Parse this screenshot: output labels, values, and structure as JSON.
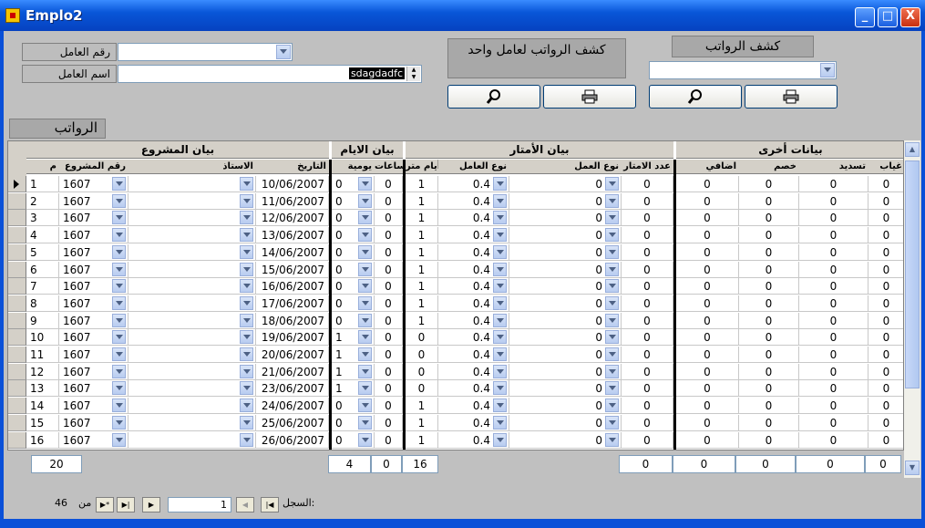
{
  "window": {
    "title": "Emplo2",
    "min": "_",
    "max": "□",
    "close": "X"
  },
  "worker": {
    "id_label": "رقم العامل",
    "name_label": "اسم العامل",
    "name_value": "sdagdadfc"
  },
  "single_report": {
    "title": "كشف الرواتب لعامل واحد",
    "preview_icon": "magnifier-icon",
    "print_icon": "printer-icon"
  },
  "payroll_report": {
    "title": "كشف الرواتب",
    "preview_icon": "magnifier-icon",
    "print_icon": "printer-icon"
  },
  "section_label": "الرواتب",
  "groups": {
    "project": "بيان المشروع",
    "days": "بيان الايام",
    "meters": "بيان الأمتار",
    "other": "بيانات أخرى"
  },
  "columns": {
    "num": "م",
    "project_no": "رقم المشروع",
    "master": "الاستاذ",
    "date": "التاريخ",
    "daily": "يومية",
    "hours": "ساعات",
    "meter_days": "أيام متر",
    "worker_type": "نوع العامل",
    "work_type": "نوع العمل",
    "meter_count": "عدد الامتار",
    "extra": "اضافي",
    "deduction": "خصم",
    "payment": "تسديد",
    "absence": "غياب"
  },
  "rows": [
    {
      "n": "1",
      "p": "1607",
      "d": "10/06/2007",
      "dy": "0",
      "h": "0",
      "md": "1",
      "wt": "0.4",
      "wk": "0",
      "mc": "0",
      "ex": "0",
      "de": "0",
      "pa": "0",
      "ab": "0"
    },
    {
      "n": "2",
      "p": "1607",
      "d": "11/06/2007",
      "dy": "0",
      "h": "0",
      "md": "1",
      "wt": "0.4",
      "wk": "0",
      "mc": "0",
      "ex": "0",
      "de": "0",
      "pa": "0",
      "ab": "0"
    },
    {
      "n": "3",
      "p": "1607",
      "d": "12/06/2007",
      "dy": "0",
      "h": "0",
      "md": "1",
      "wt": "0.4",
      "wk": "0",
      "mc": "0",
      "ex": "0",
      "de": "0",
      "pa": "0",
      "ab": "0"
    },
    {
      "n": "4",
      "p": "1607",
      "d": "13/06/2007",
      "dy": "0",
      "h": "0",
      "md": "1",
      "wt": "0.4",
      "wk": "0",
      "mc": "0",
      "ex": "0",
      "de": "0",
      "pa": "0",
      "ab": "0"
    },
    {
      "n": "5",
      "p": "1607",
      "d": "14/06/2007",
      "dy": "0",
      "h": "0",
      "md": "1",
      "wt": "0.4",
      "wk": "0",
      "mc": "0",
      "ex": "0",
      "de": "0",
      "pa": "0",
      "ab": "0"
    },
    {
      "n": "6",
      "p": "1607",
      "d": "15/06/2007",
      "dy": "0",
      "h": "0",
      "md": "1",
      "wt": "0.4",
      "wk": "0",
      "mc": "0",
      "ex": "0",
      "de": "0",
      "pa": "0",
      "ab": "0"
    },
    {
      "n": "7",
      "p": "1607",
      "d": "16/06/2007",
      "dy": "0",
      "h": "0",
      "md": "1",
      "wt": "0.4",
      "wk": "0",
      "mc": "0",
      "ex": "0",
      "de": "0",
      "pa": "0",
      "ab": "0"
    },
    {
      "n": "8",
      "p": "1607",
      "d": "17/06/2007",
      "dy": "0",
      "h": "0",
      "md": "1",
      "wt": "0.4",
      "wk": "0",
      "mc": "0",
      "ex": "0",
      "de": "0",
      "pa": "0",
      "ab": "0"
    },
    {
      "n": "9",
      "p": "1607",
      "d": "18/06/2007",
      "dy": "0",
      "h": "0",
      "md": "1",
      "wt": "0.4",
      "wk": "0",
      "mc": "0",
      "ex": "0",
      "de": "0",
      "pa": "0",
      "ab": "0"
    },
    {
      "n": "10",
      "p": "1607",
      "d": "19/06/2007",
      "dy": "1",
      "h": "0",
      "md": "0",
      "wt": "0.4",
      "wk": "0",
      "mc": "0",
      "ex": "0",
      "de": "0",
      "pa": "0",
      "ab": "0"
    },
    {
      "n": "11",
      "p": "1607",
      "d": "20/06/2007",
      "dy": "1",
      "h": "0",
      "md": "0",
      "wt": "0.4",
      "wk": "0",
      "mc": "0",
      "ex": "0",
      "de": "0",
      "pa": "0",
      "ab": "0"
    },
    {
      "n": "12",
      "p": "1607",
      "d": "21/06/2007",
      "dy": "1",
      "h": "0",
      "md": "0",
      "wt": "0.4",
      "wk": "0",
      "mc": "0",
      "ex": "0",
      "de": "0",
      "pa": "0",
      "ab": "0"
    },
    {
      "n": "13",
      "p": "1607",
      "d": "23/06/2007",
      "dy": "1",
      "h": "0",
      "md": "0",
      "wt": "0.4",
      "wk": "0",
      "mc": "0",
      "ex": "0",
      "de": "0",
      "pa": "0",
      "ab": "0"
    },
    {
      "n": "14",
      "p": "1607",
      "d": "24/06/2007",
      "dy": "0",
      "h": "0",
      "md": "1",
      "wt": "0.4",
      "wk": "0",
      "mc": "0",
      "ex": "0",
      "de": "0",
      "pa": "0",
      "ab": "0"
    },
    {
      "n": "15",
      "p": "1607",
      "d": "25/06/2007",
      "dy": "0",
      "h": "0",
      "md": "1",
      "wt": "0.4",
      "wk": "0",
      "mc": "0",
      "ex": "0",
      "de": "0",
      "pa": "0",
      "ab": "0"
    },
    {
      "n": "16",
      "p": "1607",
      "d": "26/06/2007",
      "dy": "0",
      "h": "0",
      "md": "1",
      "wt": "0.4",
      "wk": "0",
      "mc": "0",
      "ex": "0",
      "de": "0",
      "pa": "0",
      "ab": "0"
    }
  ],
  "totals": {
    "num": "20",
    "daily": "4",
    "hours": "0",
    "meter_days": "16",
    "meter_count": "0",
    "extra": "0",
    "deduction": "0",
    "payment": "0",
    "absence": "0"
  },
  "navigator": {
    "record_label": "السجل:",
    "current": "1",
    "of_label": "من",
    "total": "46"
  },
  "colors": {
    "titlebar": "#0A50D8",
    "client": "#C0C0C0",
    "grid_header": "#D4D0C8"
  }
}
